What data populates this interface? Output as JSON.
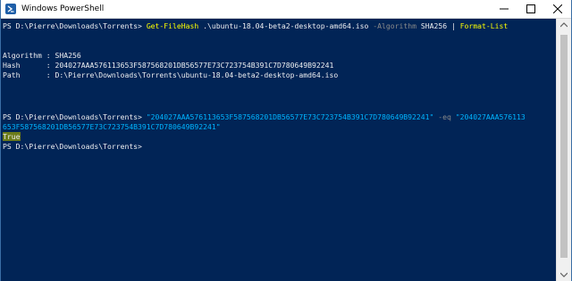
{
  "window": {
    "title": "Windows PowerShell",
    "app_icon": "powershell-icon",
    "controls": [
      "minimize-icon",
      "maximize-icon",
      "close-icon"
    ]
  },
  "console": {
    "cmd1": {
      "prompt": "PS D:\\Pierre\\Downloads\\Torrents> ",
      "cmdlet": "Get-FileHash",
      "path_arg": " .\\ubuntu-18.04-beta2-desktop-amd64.iso ",
      "param": "-Algorithm",
      "param_value": " SHA256 ",
      "pipe": "| ",
      "pipe_cmdlet": "Format-List"
    },
    "output": {
      "algorithm_line": "Algorithm : SHA256",
      "hash_line": "Hash      : 204027AAA576113653F587568201DB56577E73C723754B391C7D780649B92241",
      "path_line": "Path      : D:\\Pierre\\Downloads\\Torrents\\ubuntu-18.04-beta2-desktop-amd64.iso"
    },
    "cmd2": {
      "prompt": "PS D:\\Pierre\\Downloads\\Torrents> ",
      "string1": "\"204027AAA576113653F587568201DB56577E73C723754B391C7D780649B92241\"",
      "operator": " -eq ",
      "string2_part1": "\"204027AAA576113",
      "string2_part2": "653F587568201DB56577E73C723754B391C7D780649B92241\""
    },
    "result": "True",
    "final_prompt": "PS D:\\Pierre\\Downloads\\Torrents>",
    "colors": {
      "background": "#012456",
      "cmdlet": "#ffff00",
      "string": "#00b4ff",
      "parameter": "#8a8a8a",
      "text": "#eeedf0",
      "highlight": "#6c7b1a"
    }
  }
}
